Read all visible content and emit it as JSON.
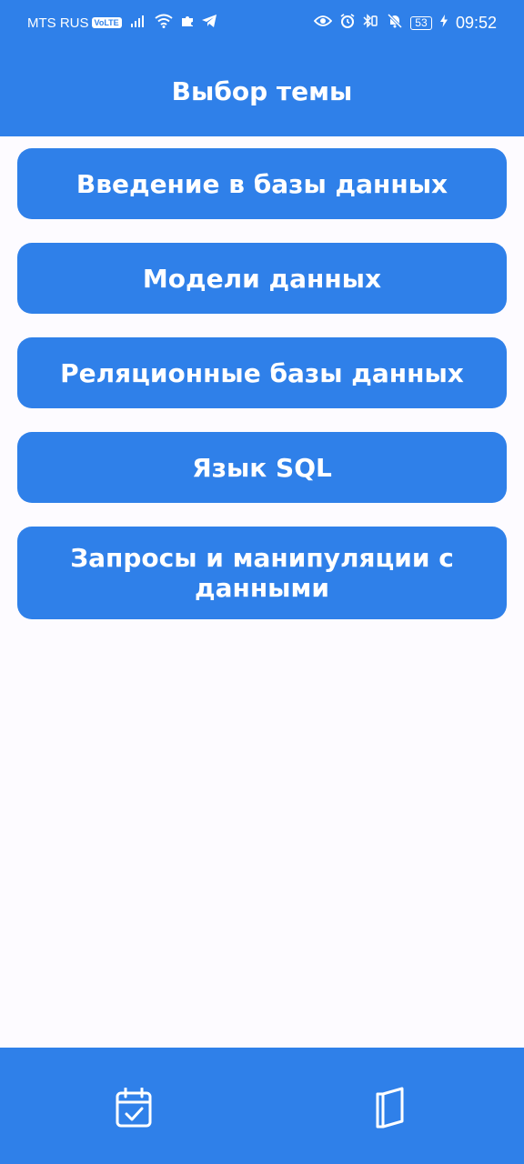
{
  "status_bar": {
    "carrier": "MTS RUS",
    "volte": "VoLTE",
    "battery": "53",
    "time": "09:52"
  },
  "app_bar": {
    "title": "Выбор темы"
  },
  "topics": [
    {
      "label": "Введение в базы данных"
    },
    {
      "label": "Модели данных"
    },
    {
      "label": "Реляционные базы данных"
    },
    {
      "label": "Язык SQL"
    },
    {
      "label": "Запросы и манипуляции с данными"
    }
  ],
  "bottom_nav": {
    "items": [
      {
        "icon": "calendar-check-icon"
      },
      {
        "icon": "book-icon"
      }
    ]
  },
  "colors": {
    "primary": "#2f80e9",
    "background": "#fdfbff",
    "on_primary": "#ffffff"
  }
}
